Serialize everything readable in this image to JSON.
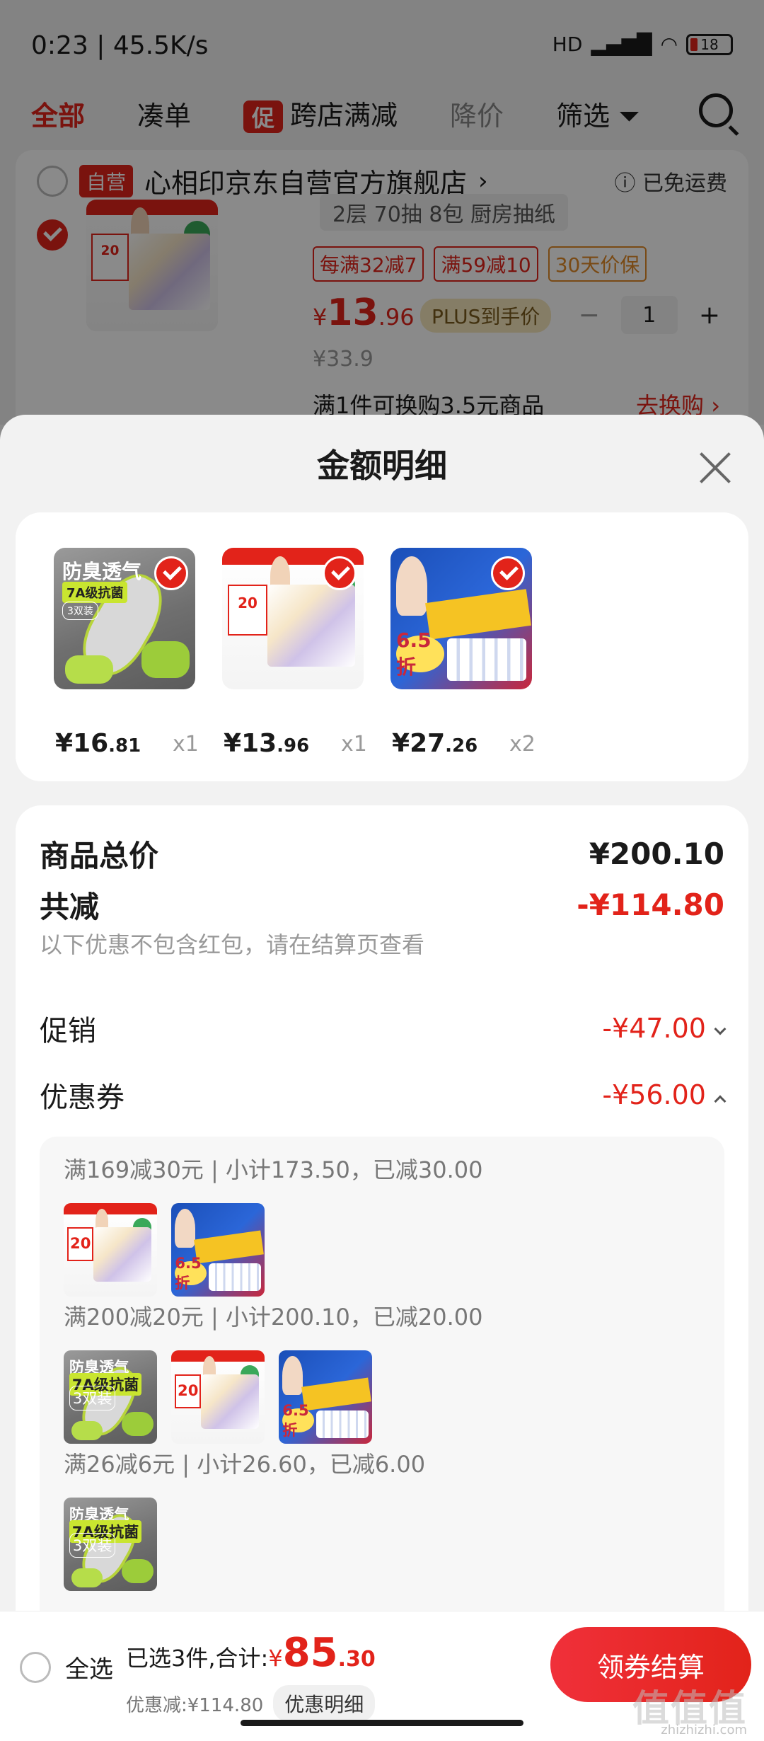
{
  "status_bar": {
    "time": "0:23 | 45.5K/s",
    "network": "HD",
    "battery": "18"
  },
  "tabs": [
    {
      "label": "全部"
    },
    {
      "label": "凑单"
    },
    {
      "badge": "促",
      "label": "跨店满减"
    },
    {
      "label": "降价"
    },
    {
      "label": "筛选"
    }
  ],
  "store": {
    "badge": "自营",
    "name": "心相印京东自营官方旗舰店",
    "shipping": "已免运费",
    "item": {
      "spec": "2层 70抽 8包 厨房抽纸",
      "tags": [
        "每满32减7",
        "满59减10",
        "30天价保"
      ],
      "price_symbol": "¥",
      "price_int": "13",
      "price_dec": ".96",
      "plus_tag": "PLUS到手价",
      "qty": "1",
      "minus": "−",
      "plus": "+",
      "orig_price": "¥33.9",
      "exchange": "满1件可换购3.5元商品",
      "exchange_link": "去换购 ›"
    }
  },
  "sheet": {
    "title": "金额明细",
    "products": [
      {
        "symbol": "¥",
        "int": "16",
        "dec": ".81",
        "qty": "x1",
        "art": {
          "t1": "防臭透气",
          "t2": "7A级抗菌",
          "t3": "3双装"
        }
      },
      {
        "symbol": "¥",
        "int": "13",
        "dec": ".96",
        "qty": "x1",
        "art": {
          "promo": "20"
        }
      },
      {
        "symbol": "¥",
        "int": "27",
        "dec": ".26",
        "qty": "x2",
        "art": {
          "badge": "6.5折"
        }
      }
    ],
    "total_label": "商品总价",
    "total_value": "¥200.10",
    "reduce_label": "共减",
    "reduce_value": "-¥114.80",
    "note": "以下优惠不包含红包，请在结算页查看",
    "promo_label": "促销",
    "promo_value": "-¥47.00",
    "coupon_label": "优惠券",
    "coupon_value": "-¥56.00",
    "coupons": [
      {
        "text": "满169减30元 | 小计173.50，已减30.00"
      },
      {
        "text": "满200减20元 | 小计200.10，已减20.00"
      },
      {
        "text": "满26减6元 | 小计26.60，已减6.00"
      }
    ]
  },
  "bottom_bar": {
    "select_all": "全选",
    "summary_prefix": "已选3件,合计:",
    "currency": "¥",
    "total_int": "85",
    "total_dec": ".30",
    "saved": "优惠减:¥114.80",
    "detail_button": "优惠明细",
    "checkout": "领券结算"
  },
  "watermark": {
    "main": "值值值",
    "sub": "zhizhizhi.com"
  },
  "colors": {
    "accent": "#e2231a",
    "plus_gold": "#f6e7bc",
    "sheet_bg": "#f2f2f2"
  }
}
